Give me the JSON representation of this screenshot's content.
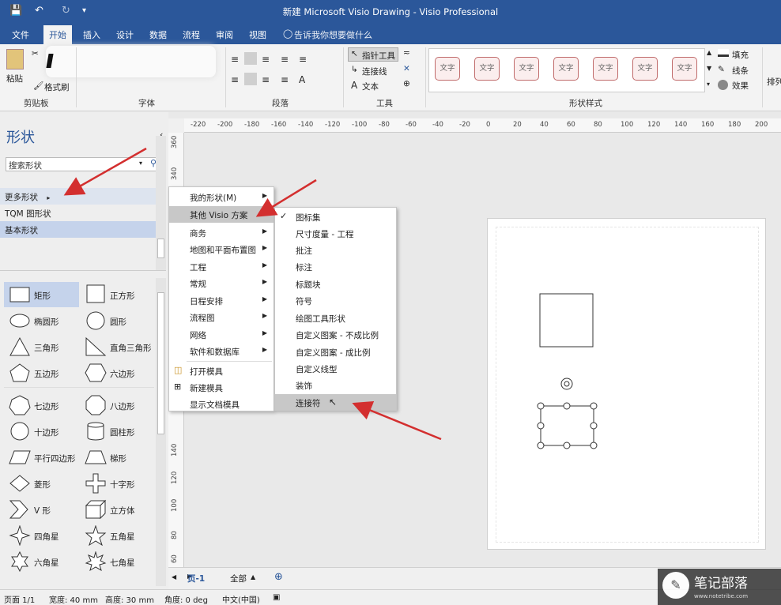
{
  "window": {
    "title": "新建 Microsoft Visio Drawing  -  Visio Professional"
  },
  "tabs": [
    "文件",
    "开始",
    "插入",
    "设计",
    "数据",
    "流程",
    "审阅",
    "视图"
  ],
  "tell_me": "告诉我你想要做什么",
  "ribbon": {
    "paste": "粘贴",
    "format_painter": "格式刷",
    "clipboard": "剪贴板",
    "font": "字体",
    "paragraph": "段落",
    "pointer_tool": "指针工具",
    "connector": "连接线",
    "text": "文本",
    "tools": "工具",
    "style_label": "文字",
    "shape_styles": "形状样式",
    "fill": "填充",
    "line": "线条",
    "effects": "效果",
    "arrange": "排列"
  },
  "shapes_panel": {
    "title": "形状",
    "search_placeholder": "搜索形状",
    "more_shapes": "更多形状",
    "tqm": "TQM 图形状",
    "basic": "基本形状",
    "items": [
      "矩形",
      "正方形",
      "椭圆形",
      "圆形",
      "三角形",
      "直角三角形",
      "五边形",
      "六边形",
      "七边形",
      "八边形",
      "十边形",
      "圆柱形",
      "平行四边形",
      "梯形",
      "菱形",
      "十字形",
      "V 形",
      "立方体",
      "四角星",
      "五角星",
      "六角星",
      "七角星"
    ]
  },
  "hruler_ticks": [
    "-220",
    "-200",
    "-180",
    "-160",
    "-140",
    "-120",
    "-100",
    "-80",
    "-60",
    "-40",
    "-20",
    "0",
    "20",
    "40",
    "60",
    "80",
    "100",
    "120",
    "140",
    "160",
    "180",
    "200"
  ],
  "vruler_ticks": [
    "360",
    "340",
    "140",
    "120",
    "100",
    "80",
    "60"
  ],
  "menu1": {
    "items": [
      "我的形状(M)",
      "其他 Visio 方案",
      "商务",
      "地图和平面布置图",
      "工程",
      "常规",
      "日程安排",
      "流程图",
      "网络",
      "软件和数据库"
    ],
    "items2": [
      "打开模具",
      "新建模具",
      "显示文档模具"
    ]
  },
  "menu2": {
    "items": [
      "图标集",
      "尺寸度量 - 工程",
      "批注",
      "标注",
      "标题块",
      "符号",
      "绘图工具形状",
      "自定义图案 - 不成比例",
      "自定义图案 - 成比例",
      "自定义线型",
      "装饰",
      "连接符"
    ]
  },
  "page_tabs": {
    "page": "页-1",
    "all": "全部"
  },
  "status": {
    "page": "页面 1/1",
    "width": "宽度: 40 mm",
    "height": "高度: 30 mm",
    "angle": "角度: 0 deg",
    "lang": "中文(中国)"
  },
  "watermark": {
    "text": "笔记部落",
    "url": "www.notetribe.com"
  },
  "colors": {
    "accent": "#2b579a",
    "arrow": "#d32f2f"
  }
}
